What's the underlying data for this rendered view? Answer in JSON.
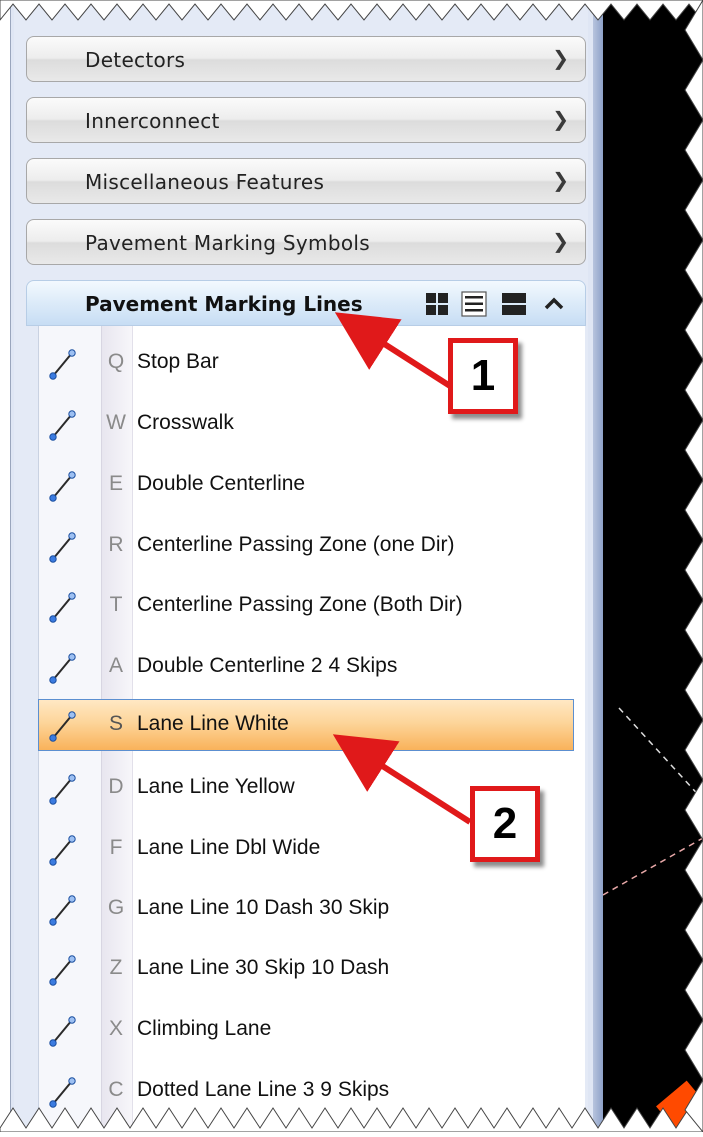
{
  "sections": [
    {
      "label": "Detectors"
    },
    {
      "label": "Innerconnect"
    },
    {
      "label": "Miscellaneous Features"
    },
    {
      "label": "Pavement Marking Symbols"
    }
  ],
  "expanded_section": {
    "label": "Pavement Marking Lines",
    "view_icons": [
      "grid-view-icon",
      "list-view-icon",
      "detail-view-icon"
    ],
    "collapse_icon": "chevron-up-icon"
  },
  "items": [
    {
      "key": "Q",
      "label": "Stop Bar"
    },
    {
      "key": "W",
      "label": "Crosswalk"
    },
    {
      "key": "E",
      "label": "Double Centerline"
    },
    {
      "key": "R",
      "label": "Centerline Passing Zone (one Dir)"
    },
    {
      "key": "T",
      "label": "Centerline Passing Zone (Both Dir)"
    },
    {
      "key": "A",
      "label": "Double Centerline 2 4 Skips"
    },
    {
      "key": "S",
      "label": "Lane Line White",
      "selected": true
    },
    {
      "key": "D",
      "label": "Lane Line Yellow"
    },
    {
      "key": "F",
      "label": "Lane Line Dbl Wide"
    },
    {
      "key": "G",
      "label": "Lane Line 10 Dash 30 Skip"
    },
    {
      "key": "Z",
      "label": "Lane Line 30 Skip 10 Dash"
    },
    {
      "key": "X",
      "label": "Climbing Lane"
    },
    {
      "key": "C",
      "label": "Dotted Lane Line 3 9 Skips"
    }
  ],
  "callouts": [
    {
      "number": "1"
    },
    {
      "number": "2"
    }
  ],
  "colors": {
    "selection": "#f9b25a",
    "callout": "#e0191a",
    "canvas": "#000000"
  }
}
